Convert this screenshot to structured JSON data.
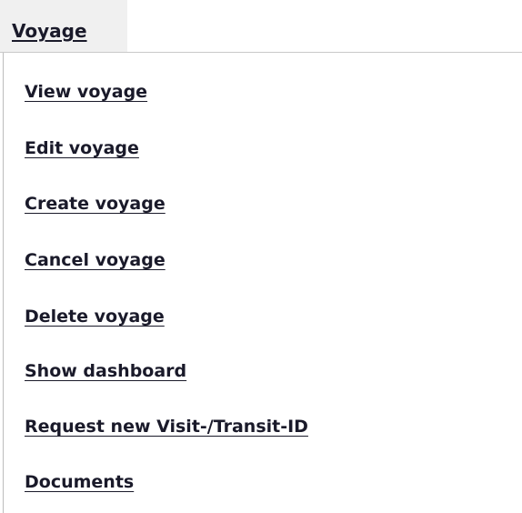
{
  "menu": {
    "title": "Voyage",
    "items": [
      {
        "label": "View voyage"
      },
      {
        "label": "Edit voyage"
      },
      {
        "label": "Create voyage"
      },
      {
        "label": "Cancel voyage"
      },
      {
        "label": "Delete voyage"
      },
      {
        "label": "Show dashboard"
      },
      {
        "label": "Request new Visit-/Transit-ID"
      },
      {
        "label": "Documents"
      }
    ]
  }
}
